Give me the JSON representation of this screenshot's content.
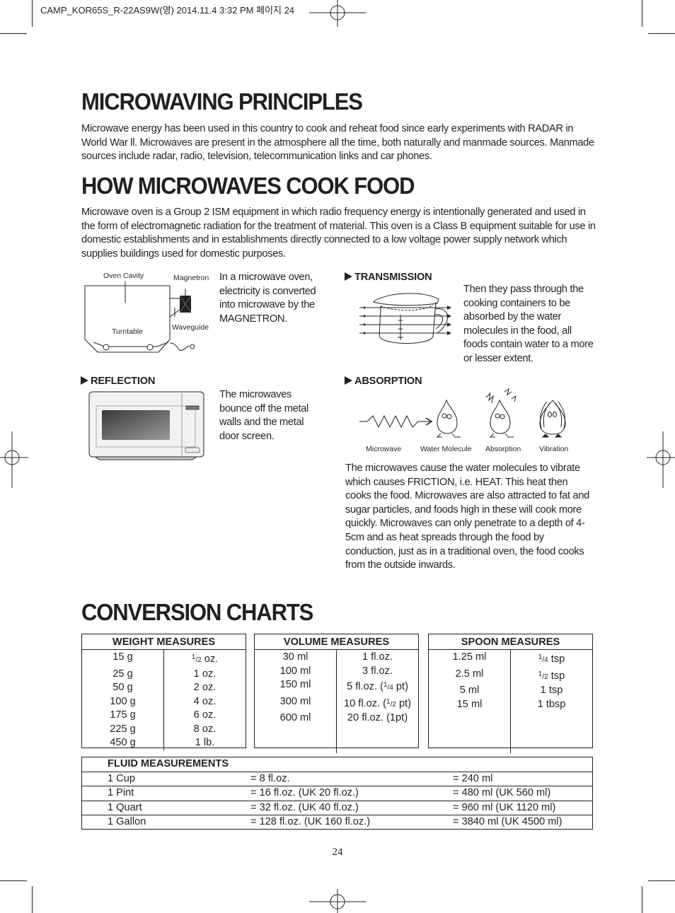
{
  "slug": "CAMP_KOR65S_R-22AS9W(영) 2014.11.4 3:32 PM 페이지 24",
  "sections": {
    "principles": {
      "title": "MICROWAVING PRINCIPLES",
      "text": "Microwave energy has been used in this country to cook and reheat food since early experiments with RADAR in World War ll. Microwaves are present in the atmosphere all the time, both naturally and manmade sources. Manmade sources include radar, radio, television, telecommunication links and car phones."
    },
    "how_cook": {
      "title": "HOW MICROWAVES COOK FOOD",
      "text": "Microwave oven is a Group 2 ISM equipment in which radio frequency energy is intentionally generated and used in the form of electromagnetic radiation for the treatment of material. This oven is a Class B equipment suitable for use in domestic establishments and in establishments directly connected to a low voltage power supply network which supplies buildings used for domestic purposes."
    },
    "oven_diagram": {
      "labels": {
        "oven_cavity": "Oven Cavity",
        "magnetron": "Magnetron",
        "turntable": "Turntable",
        "waveguide": "Waveguide"
      },
      "text": "In a microwave oven, electricity is converted into microwave by the MAGNETRON."
    },
    "transmission": {
      "heading": "TRANSMISSION",
      "text": "Then they pass through the cooking containers to be absorbed by the water molecules in the food, all foods contain water to a more or lesser extent."
    },
    "reflection": {
      "heading": "REFLECTION",
      "text": "The microwaves bounce off the metal walls and the metal door screen."
    },
    "absorption": {
      "heading": "ABSORPTION",
      "labels": [
        "Microwave",
        "Water Molecule",
        "Absorption",
        "Vibration"
      ],
      "text": "The microwaves cause the water molecules to vibrate which causes FRICTION, i.e. HEAT. This heat then cooks the food. Microwaves are also attracted to fat and sugar particles, and foods high in these will cook more quickly. Microwaves can only penetrate to a depth of 4-5cm and as heat spreads through the food by conduction, just as in a traditional oven, the food cooks from the outside inwards."
    },
    "conversion": {
      "title": "CONVERSION CHARTS",
      "weight": {
        "header": "WEIGHT MEASURES",
        "rows": [
          [
            "15 g",
            "½ oz."
          ],
          [
            "25 g",
            "1 oz."
          ],
          [
            "50 g",
            "2 oz."
          ],
          [
            "100 g",
            "4 oz."
          ],
          [
            "175 g",
            "6 oz."
          ],
          [
            "225 g",
            "8 oz."
          ],
          [
            "450 g",
            "1 lb."
          ]
        ]
      },
      "volume": {
        "header": "VOLUME MEASURES",
        "rows": [
          [
            "30 ml",
            "1 fl.oz."
          ],
          [
            "100 ml",
            "3 fl.oz."
          ],
          [
            "150 ml",
            "5 fl.oz. (¼ pt)"
          ],
          [
            "300 ml",
            "10 fl.oz. (½ pt)"
          ],
          [
            "600 ml",
            "20 fl.oz. (1pt)"
          ],
          [
            "",
            ""
          ],
          [
            "",
            ""
          ]
        ]
      },
      "spoon": {
        "header": "SPOON MEASURES",
        "rows": [
          [
            "1.25 ml",
            "¼ tsp"
          ],
          [
            "2.5 ml",
            "½ tsp"
          ],
          [
            "5 ml",
            "1 tsp"
          ],
          [
            "15 ml",
            "1 tbsp"
          ],
          [
            "",
            ""
          ],
          [
            "",
            ""
          ],
          [
            "",
            ""
          ]
        ]
      },
      "fluid": {
        "header": "FLUID MEASUREMENTS",
        "rows": [
          [
            "1 Cup",
            "= 8 fl.oz.",
            "= 240 ml"
          ],
          [
            "1 Pint",
            "= 16 fl.oz. (UK 20 fl.oz.)",
            "= 480 ml (UK 560 ml)"
          ],
          [
            "1 Quart",
            "= 32 fl.oz. (UK 40 fl.oz.)",
            "= 960 ml (UK 1120 ml)"
          ],
          [
            "1 Gallon",
            "= 128 fl.oz. (UK 160 fl.oz.)",
            "= 3840 ml (UK 4500 ml)"
          ]
        ]
      }
    }
  },
  "page_number": "24"
}
